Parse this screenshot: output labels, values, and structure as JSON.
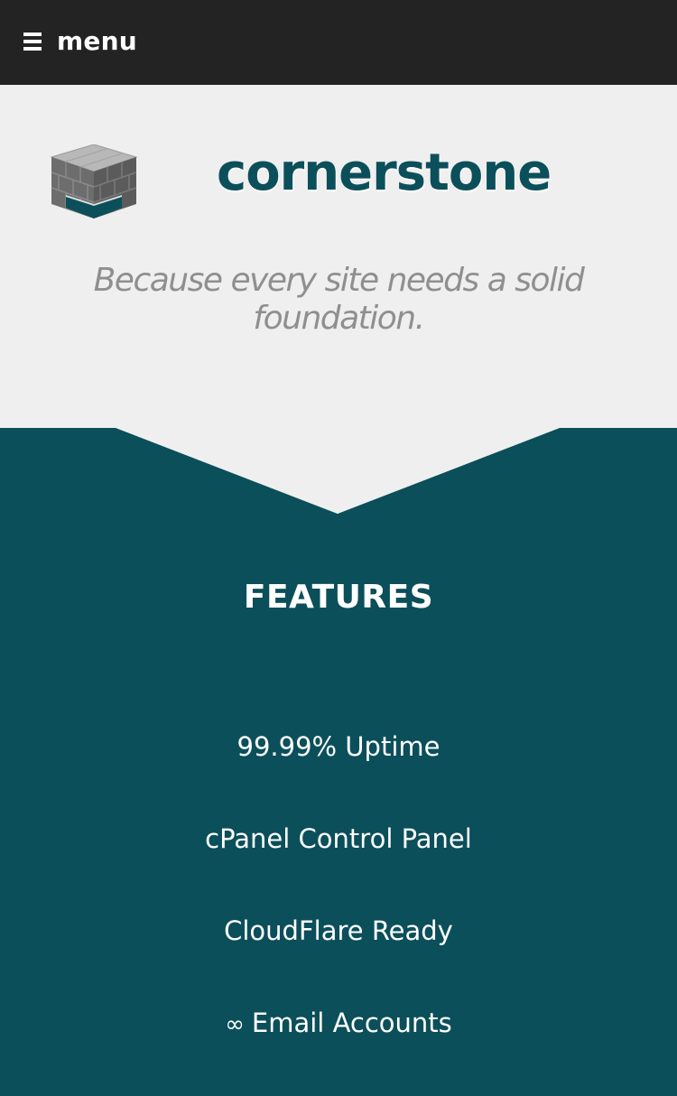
{
  "nav": {
    "menu_icon": "hamburger-icon",
    "menu_label": "menu"
  },
  "hero": {
    "logo_icon": "brick-cube-logo",
    "brand": "cornerstone",
    "tagline": "Because every site needs a solid foundation."
  },
  "features": {
    "title": "FEATURES",
    "items": [
      {
        "prefix": "",
        "label": "99.99% Uptime"
      },
      {
        "prefix": "",
        "label": "cPanel Control Panel"
      },
      {
        "prefix": "",
        "label": "CloudFlare Ready"
      },
      {
        "prefix": "∞",
        "label": "Email Accounts"
      }
    ]
  },
  "colors": {
    "topbar": "#232323",
    "hero_bg": "#efefef",
    "brand_teal": "#0b4f5a",
    "tagline_gray": "#8f8f8f",
    "text_white": "#ffffff"
  }
}
